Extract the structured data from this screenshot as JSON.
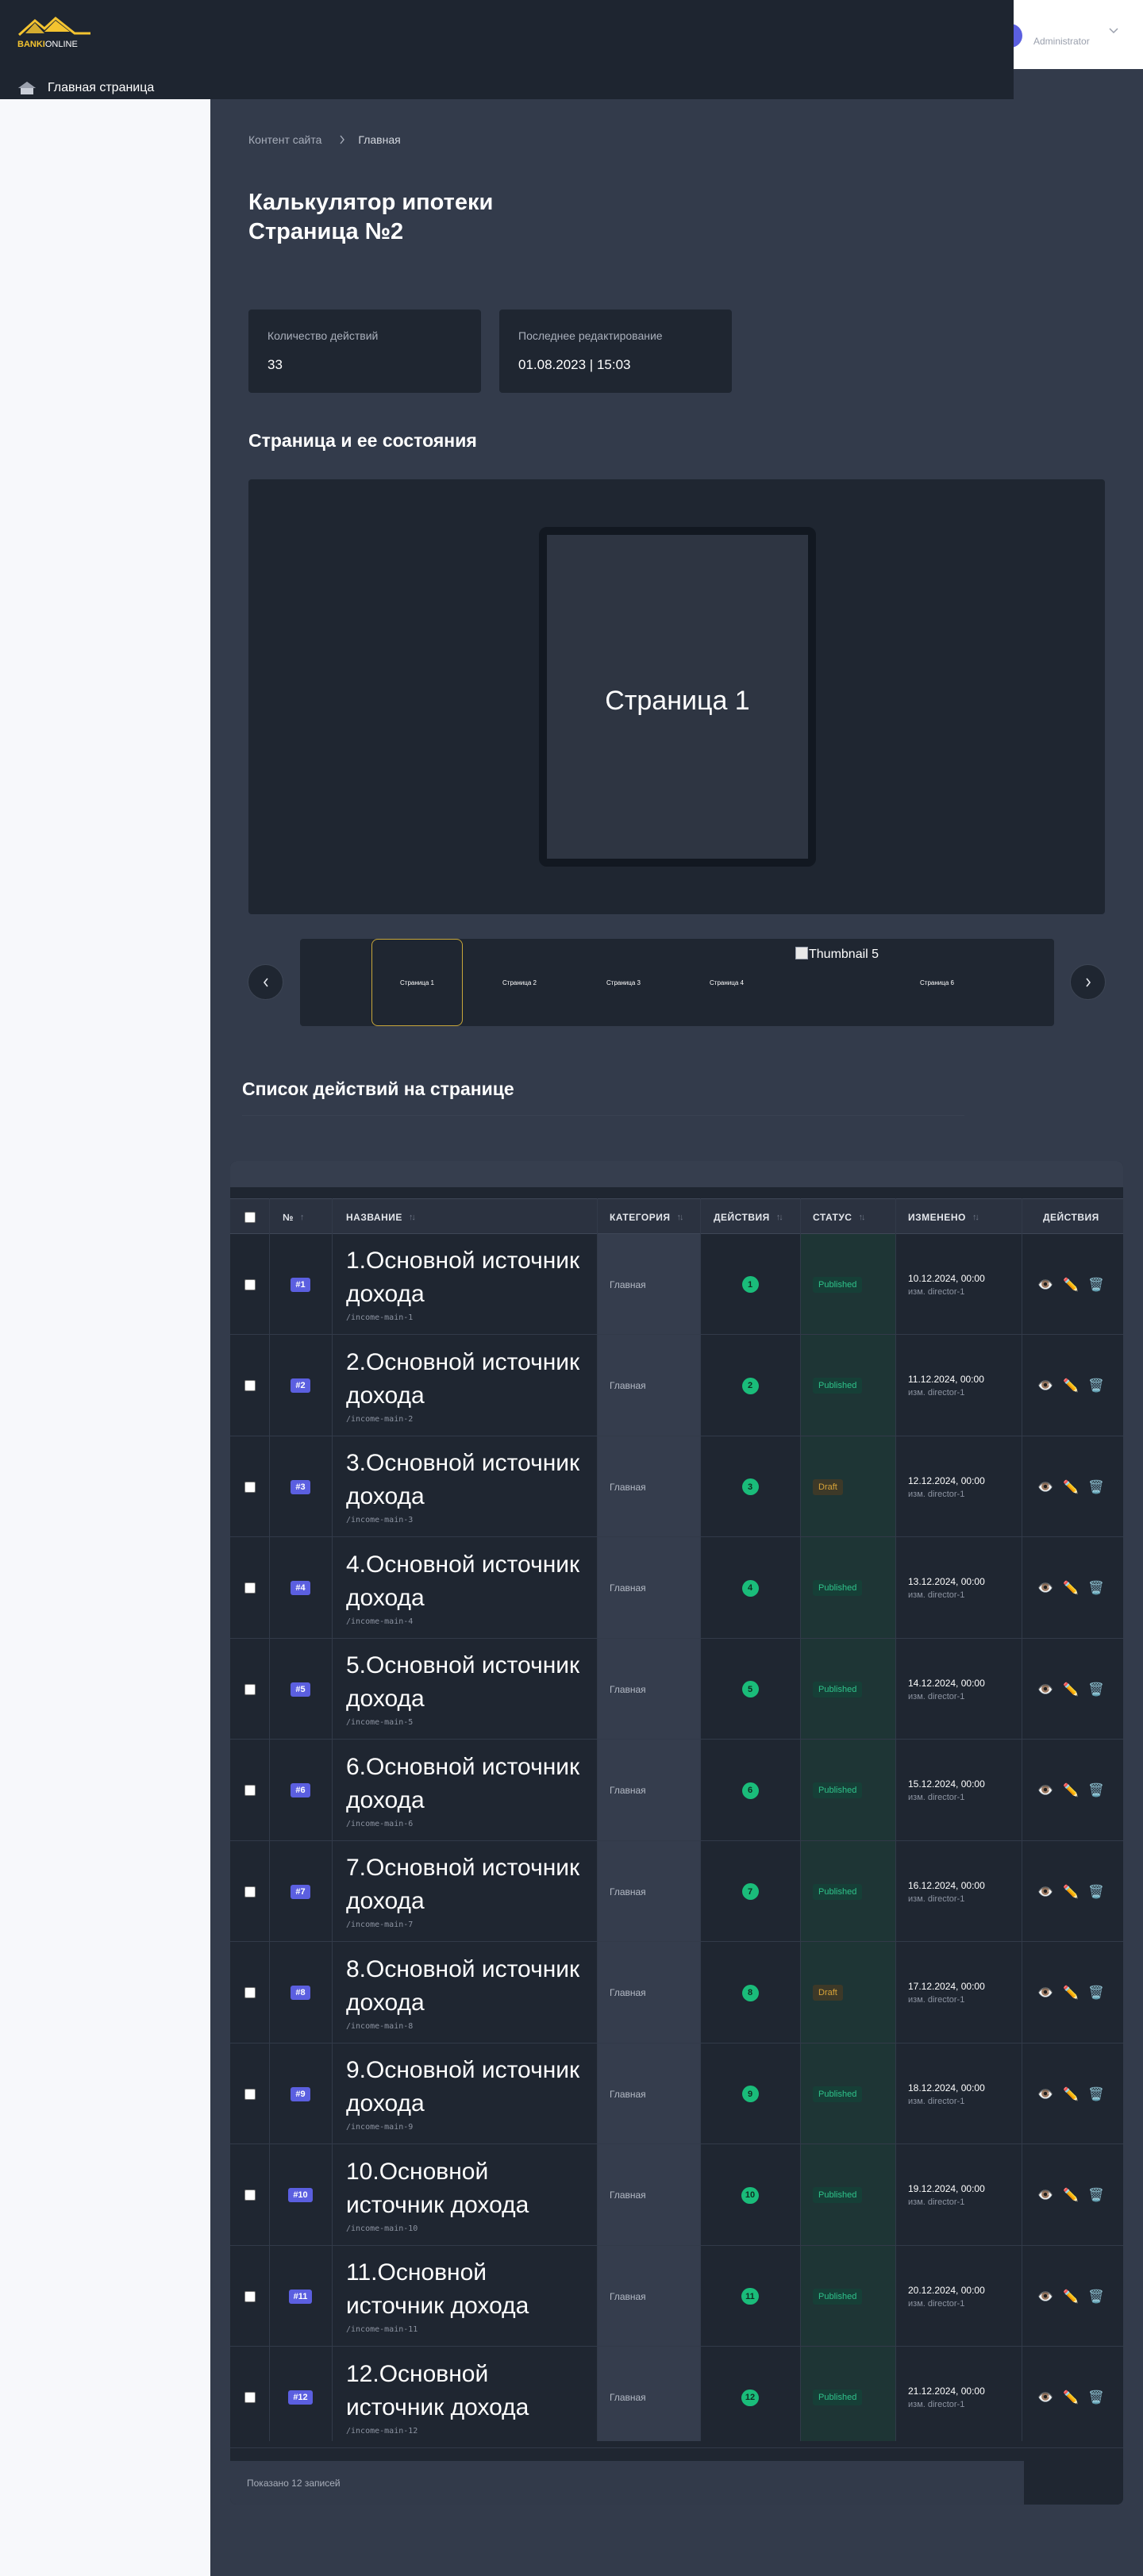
{
  "brand": {
    "logo_part1": "BANKI",
    "logo_part2": "ONLINE",
    "accent": "#f4c430"
  },
  "header": {
    "home_label": "Главная страница",
    "home_icon": "home-icon"
  },
  "user": {
    "role": "Administrator"
  },
  "breadcrumb": {
    "items": [
      "Контент сайта",
      "Главная"
    ]
  },
  "page": {
    "title_line1": "Калькулятор ипотеки",
    "title_line2": "Страница №2"
  },
  "stats": [
    {
      "label": "Количество действий",
      "value": "33"
    },
    {
      "label": "Последнее редактирование",
      "value": "01.08.2023 | 15:03"
    }
  ],
  "preview": {
    "section_title": "Страница и ее состояния",
    "current_title": "Страница 1",
    "thumbnails": [
      "Страница 1",
      "Страница 2",
      "Страница 3",
      "Страница 4",
      "Thumbnail 5",
      "Страница 6"
    ]
  },
  "actions": {
    "section_title": "Список действий на странице",
    "columns": {
      "num": "№",
      "name": "НАЗВАНИЕ",
      "category": "КАТЕГОРИЯ",
      "actions": "ДЕЙСТВИЯ",
      "status": "СТАТУС",
      "modified": "ИЗМЕНЕНО",
      "row_actions": "ДЕЙСТВИЯ"
    },
    "rows": [
      {
        "id": "#1",
        "title": "1.Основной источник дохода",
        "slug": "/income-main-1",
        "category": "Главная",
        "actions": "1",
        "status": "Published",
        "date": "10.12.2024, 00:00",
        "by": "изм. director-1"
      },
      {
        "id": "#2",
        "title": "2.Основной источник дохода",
        "slug": "/income-main-2",
        "category": "Главная",
        "actions": "2",
        "status": "Published",
        "date": "11.12.2024, 00:00",
        "by": "изм. director-1"
      },
      {
        "id": "#3",
        "title": "3.Основной источник дохода",
        "slug": "/income-main-3",
        "category": "Главная",
        "actions": "3",
        "status": "Draft",
        "date": "12.12.2024, 00:00",
        "by": "изм. director-1"
      },
      {
        "id": "#4",
        "title": "4.Основной источник дохода",
        "slug": "/income-main-4",
        "category": "Главная",
        "actions": "4",
        "status": "Published",
        "date": "13.12.2024, 00:00",
        "by": "изм. director-1"
      },
      {
        "id": "#5",
        "title": "5.Основной источник дохода",
        "slug": "/income-main-5",
        "category": "Главная",
        "actions": "5",
        "status": "Published",
        "date": "14.12.2024, 00:00",
        "by": "изм. director-1"
      },
      {
        "id": "#6",
        "title": "6.Основной источник дохода",
        "slug": "/income-main-6",
        "category": "Главная",
        "actions": "6",
        "status": "Published",
        "date": "15.12.2024, 00:00",
        "by": "изм. director-1"
      },
      {
        "id": "#7",
        "title": "7.Основной источник дохода",
        "slug": "/income-main-7",
        "category": "Главная",
        "actions": "7",
        "status": "Published",
        "date": "16.12.2024, 00:00",
        "by": "изм. director-1"
      },
      {
        "id": "#8",
        "title": "8.Основной источник дохода",
        "slug": "/income-main-8",
        "category": "Главная",
        "actions": "8",
        "status": "Draft",
        "date": "17.12.2024, 00:00",
        "by": "изм. director-1"
      },
      {
        "id": "#9",
        "title": "9.Основной источник дохода",
        "slug": "/income-main-9",
        "category": "Главная",
        "actions": "9",
        "status": "Published",
        "date": "18.12.2024, 00:00",
        "by": "изм. director-1"
      },
      {
        "id": "#10",
        "title": "10.Основной источник дохода",
        "slug": "/income-main-10",
        "category": "Главная",
        "actions": "10",
        "status": "Published",
        "date": "19.12.2024, 00:00",
        "by": "изм. director-1"
      },
      {
        "id": "#11",
        "title": "11.Основной источник дохода",
        "slug": "/income-main-11",
        "category": "Главная",
        "actions": "11",
        "status": "Published",
        "date": "20.12.2024, 00:00",
        "by": "изм. director-1"
      },
      {
        "id": "#12",
        "title": "12.Основной источник дохода",
        "slug": "/income-main-12",
        "category": "Главная",
        "actions": "12",
        "status": "Published",
        "date": "21.12.2024, 00:00",
        "by": "изм. director-1"
      }
    ],
    "footer_text": "Показано 12 записей",
    "row_action_icons": [
      "eye-icon",
      "pencil-icon",
      "trash-icon"
    ]
  }
}
